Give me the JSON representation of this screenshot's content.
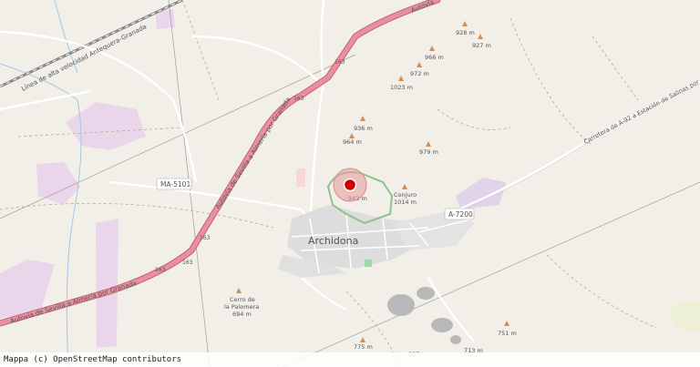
{
  "map": {
    "town": "Archidona",
    "roads": {
      "autovia_sw": "Autovía de Sevilla a Almería por Granada",
      "autovia_ne": "Autovía de Sevilla a Almería por Granada",
      "autovia_top": "Autovía",
      "rail": "Línea de alta velocidad Antequera-Granada",
      "carretera": "Carretera de A-92 a Estación de Salinas por Archidona",
      "ma5101": "MA-5101",
      "a7200": "A-7200",
      "r163a": "163",
      "r163b": "163",
      "r163c": "163",
      "r163d": "163",
      "r163e": "163"
    },
    "peaks": [
      {
        "label": "928 m"
      },
      {
        "label": "927 m"
      },
      {
        "label": "966 m"
      },
      {
        "label": "972 m"
      },
      {
        "label": "1023 m"
      },
      {
        "label": "936 m"
      },
      {
        "label": "964 m"
      },
      {
        "label": "979 m"
      },
      {
        "label": "943 m"
      },
      {
        "label": "Conjuro"
      },
      {
        "label": "1014 m"
      },
      {
        "label": "Cerro de"
      },
      {
        "label": "la Palomera"
      },
      {
        "label": "694 m"
      },
      {
        "label": "775 m"
      },
      {
        "label": "751 m"
      },
      {
        "label": "927"
      },
      {
        "label": "713 m"
      }
    ],
    "marker_color": "#cc0000",
    "attribution": "Mappa (c) OpenStreetMap contributors"
  }
}
